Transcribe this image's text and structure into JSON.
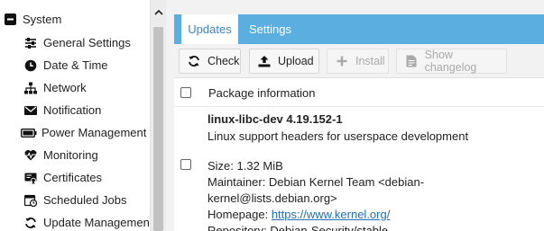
{
  "sidebar": {
    "root": {
      "label": "System",
      "icon": "collapse-minus-icon"
    },
    "items": [
      {
        "label": "General Settings",
        "icon": "sliders-icon"
      },
      {
        "label": "Date & Time",
        "icon": "clock-icon"
      },
      {
        "label": "Network",
        "icon": "network-icon"
      },
      {
        "label": "Notification",
        "icon": "envelope-icon"
      },
      {
        "label": "Power Management",
        "icon": "battery-icon"
      },
      {
        "label": "Monitoring",
        "icon": "heartbeat-icon"
      },
      {
        "label": "Certificates",
        "icon": "certificate-icon"
      },
      {
        "label": "Scheduled Jobs",
        "icon": "calendar-clock-icon"
      },
      {
        "label": "Update Management",
        "icon": "refresh-icon"
      }
    ]
  },
  "tabs": [
    {
      "label": "Updates",
      "active": true
    },
    {
      "label": "Settings",
      "active": false
    }
  ],
  "toolbar": {
    "check_label": "Check",
    "upload_label": "Upload",
    "install_label": "Install",
    "changelog_label": "Show changelog"
  },
  "table": {
    "header": "Package information",
    "rows": [
      {
        "name": "linux-libc-dev 4.19.152-1",
        "description": "Linux support headers for userspace development",
        "size": "Size: 1.32 MiB",
        "maintainer": "Maintainer: Debian Kernel Team <debian-kernel@lists.debian.org>",
        "homepage_label": "Homepage: ",
        "homepage_url": "https://www.kernel.org/",
        "repository": "Repository: Debian-Security/stable"
      }
    ]
  },
  "colors": {
    "tab_strip": "#5aaee0",
    "active_tab_text": "#3c84c2",
    "link": "#1f6fb5"
  }
}
